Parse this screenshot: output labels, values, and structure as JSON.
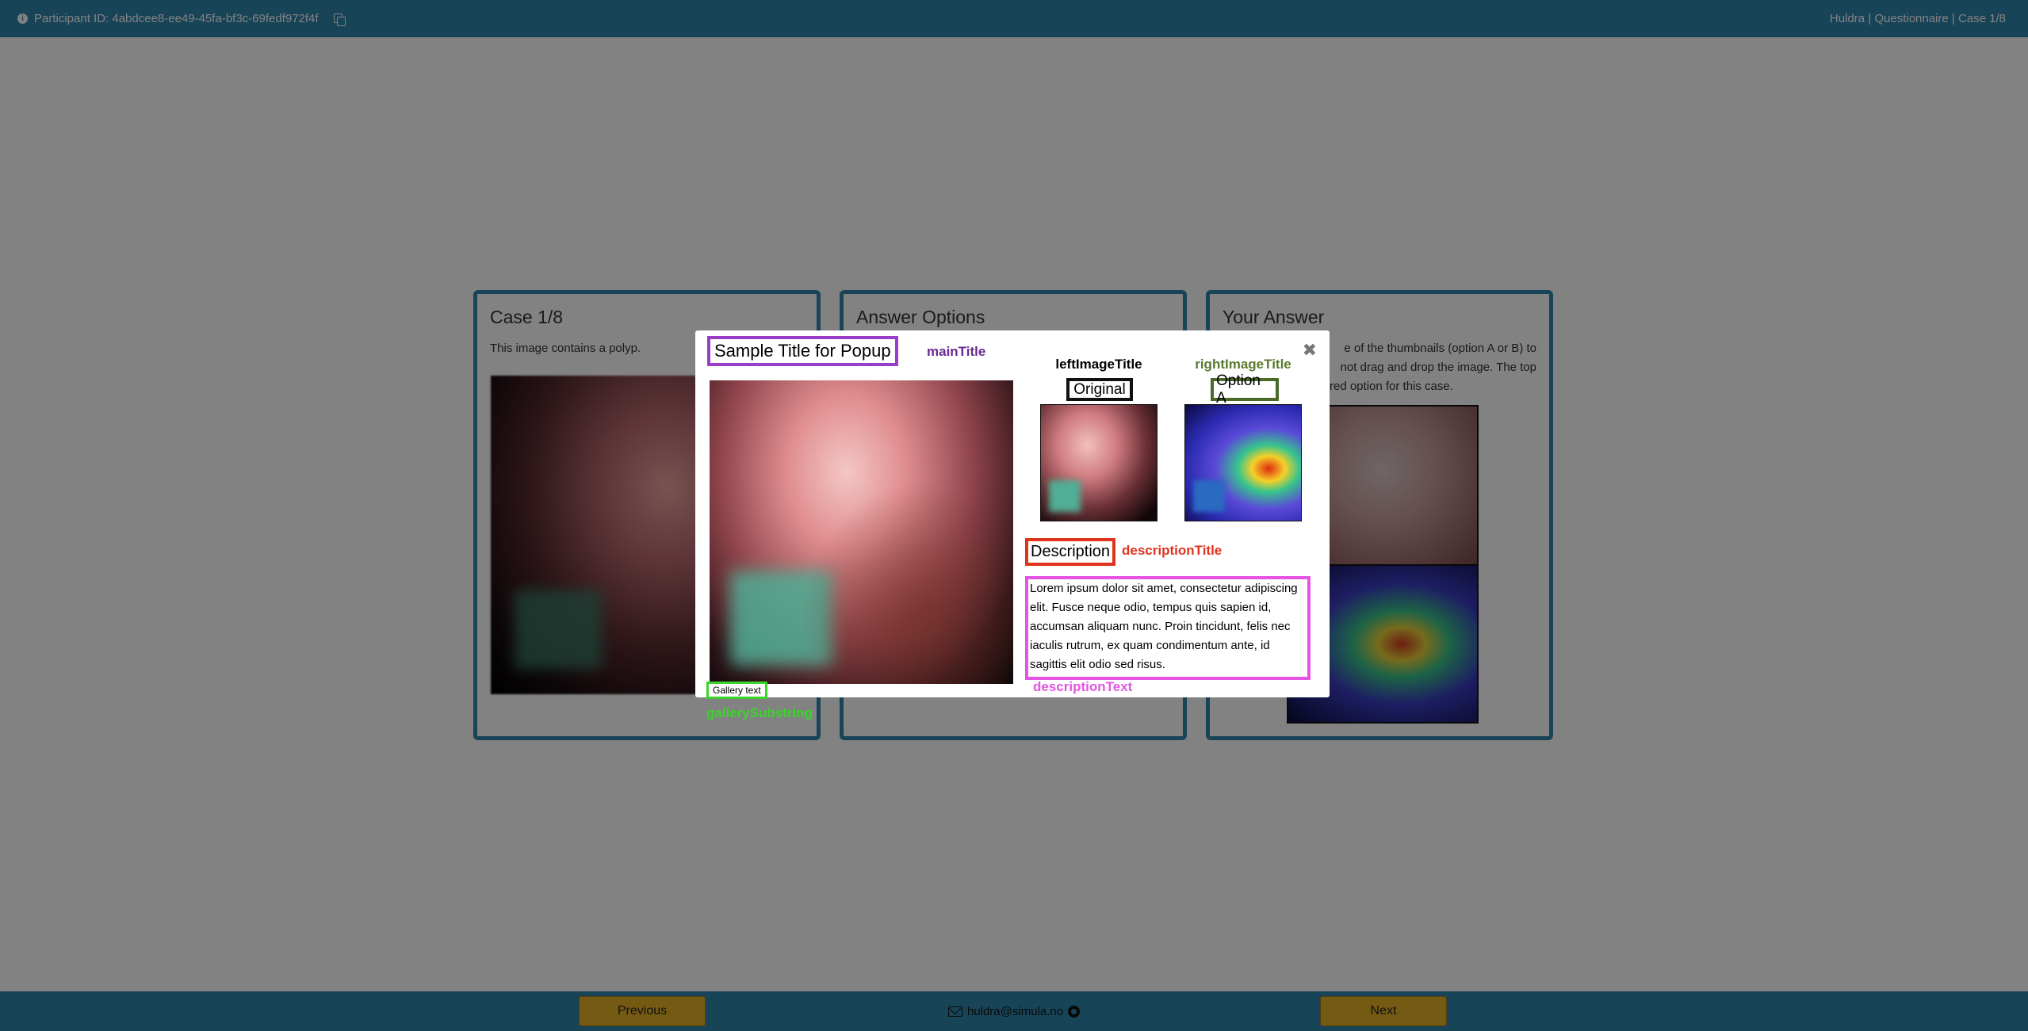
{
  "header": {
    "participant_label": "Participant ID: 4abdcee8-ee49-45fa-bf3c-69fedf972f4f",
    "app_crumb": "Huldra | Questionnaire | Case 1/8"
  },
  "panels": {
    "case": {
      "title": "Case 1/8",
      "text": "This image contains a polyp."
    },
    "answer_options": {
      "title": "Answer Options"
    },
    "your_answer": {
      "title": "Your Answer",
      "line1": "e of the thumbnails (option A or B) to",
      "line2": "not drag and drop the image. The top",
      "line3": "rred option for this case."
    }
  },
  "modal": {
    "main_title": "Sample Title for Popup",
    "main_title_tag": "mainTitle",
    "left_image_title": "leftImageTitle",
    "left_image_label": "Original",
    "right_image_title": "rightImageTitle",
    "right_image_label": "Option A",
    "description_title": "Description",
    "description_title_tag": "descriptionTitle",
    "description_text": "Lorem ipsum dolor sit amet, consectetur adipiscing elit. Fusce neque odio, tempus quis sapien id, accumsan aliquam nunc. Proin tincidunt, felis nec iaculis rutrum, ex quam condimentum ante, id sagittis elit odio sed risus.",
    "description_text_tag": "descriptionText",
    "gallery_text": "Gallery text",
    "gallery_tag": "gallerySubstring",
    "close_symbol": "✖"
  },
  "footer": {
    "previous_label": "Previous",
    "next_label": "Next",
    "email": "huldra@simula.no"
  },
  "colors": {
    "bar": "#2f86ad",
    "button": "#e4b126",
    "main_title_border": "#9b3dc9",
    "left_image_title": "#000000",
    "right_image_title": "#5a7a30",
    "description_title": "#e2331f",
    "description_text": "#e455e4",
    "gallery": "#3bd42a"
  }
}
